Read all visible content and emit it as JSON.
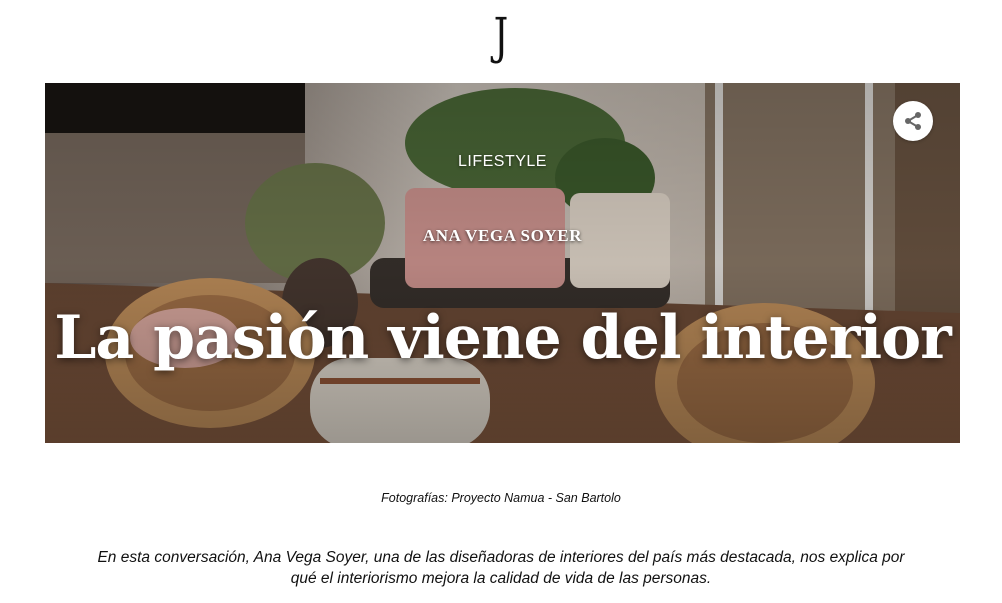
{
  "header": {
    "logo_text": "J"
  },
  "hero": {
    "category": "LIFESTYLE",
    "author": "ANA VEGA SOYER",
    "title": "La pasión viene del interior",
    "share_icon": "share-icon"
  },
  "article": {
    "photo_credit": "Fotografías: Proyecto Namua - San Bartolo",
    "lead": "En esta conversación, Ana Vega Soyer, una de las diseñadoras de interiores del país más destacada, nos explica por qué el interiorismo mejora la calidad de vida de las personas."
  },
  "colors": {
    "text": "#111111",
    "hero_text": "#ffffff",
    "share_bg": "#ffffff",
    "share_icon": "#666666"
  }
}
